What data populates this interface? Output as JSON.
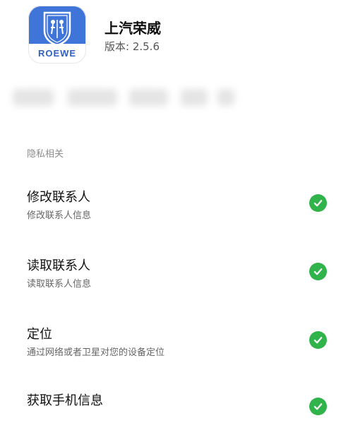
{
  "app": {
    "name": "上汽荣威",
    "version": "版本: 2.5.6",
    "icon_brand": "ROEWE",
    "icon_color": "#3f74d9"
  },
  "section": {
    "title": "隐私相关"
  },
  "permissions": [
    {
      "title": "修改联系人",
      "description": "修改联系人信息",
      "granted": true
    },
    {
      "title": "读取联系人",
      "description": "读取联系人信息",
      "granted": true
    },
    {
      "title": "定位",
      "description": "通过网络或者卫星对您的设备定位",
      "granted": true
    },
    {
      "title": "获取手机信息",
      "description": "",
      "granted": true
    }
  ],
  "colors": {
    "check": "#2fb34a",
    "muted": "#8c8c8c"
  }
}
